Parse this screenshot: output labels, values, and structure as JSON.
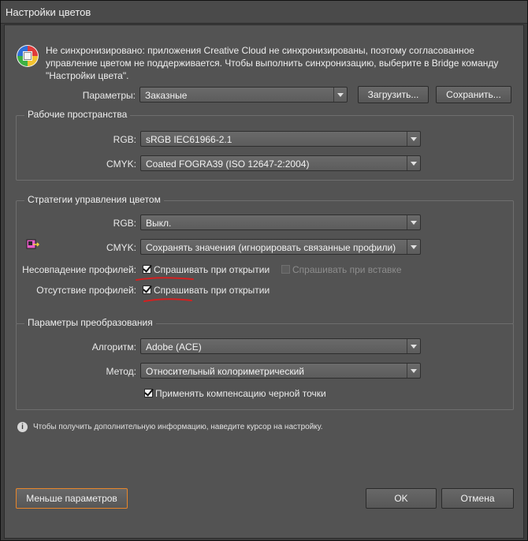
{
  "window": {
    "title": "Настройки цветов"
  },
  "sync_message": "Не синхронизировано: приложения Creative Cloud не синхронизированы, поэтому согласованное управление цветом не поддерживается. Чтобы выполнить синхронизацию, выберите в Bridge команду \"Настройки цвета\".",
  "settings": {
    "label": "Параметры:",
    "value": "Заказные",
    "load_button": "Загрузить...",
    "save_button": "Сохранить..."
  },
  "working_spaces": {
    "title": "Рабочие пространства",
    "rgb_label": "RGB:",
    "rgb_value": "sRGB IEC61966-2.1",
    "cmyk_label": "CMYK:",
    "cmyk_value": "Coated FOGRA39 (ISO 12647-2:2004)"
  },
  "policies": {
    "title": "Стратегии управления цветом",
    "rgb_label": "RGB:",
    "rgb_value": "Выкл.",
    "cmyk_label": "CMYK:",
    "cmyk_value": "Сохранять значения (игнорировать связанные профили)",
    "mismatch_label": "Несовпадение профилей:",
    "mismatch_ask_open": {
      "label": "Спрашивать при открытии",
      "checked": true
    },
    "mismatch_ask_paste": {
      "label": "Спрашивать при вставке",
      "checked": false,
      "disabled": true
    },
    "missing_label": "Отсутствие профилей:",
    "missing_ask_open": {
      "label": "Спрашивать при открытии",
      "checked": true
    }
  },
  "conversion": {
    "title": "Параметры преобразования",
    "engine_label": "Алгоритм:",
    "engine_value": "Adobe (ACE)",
    "intent_label": "Метод:",
    "intent_value": "Относительный колориметрический",
    "bpc": {
      "label": "Применять компенсацию черной точки",
      "checked": true
    }
  },
  "info_text": "Чтобы получить дополнительную информацию, наведите курсор на настройку.",
  "footer": {
    "fewer_options": "Меньше параметров",
    "ok": "OK",
    "cancel": "Отмена"
  },
  "annotation_color": "#d42020",
  "accent_color": "#e8862a"
}
